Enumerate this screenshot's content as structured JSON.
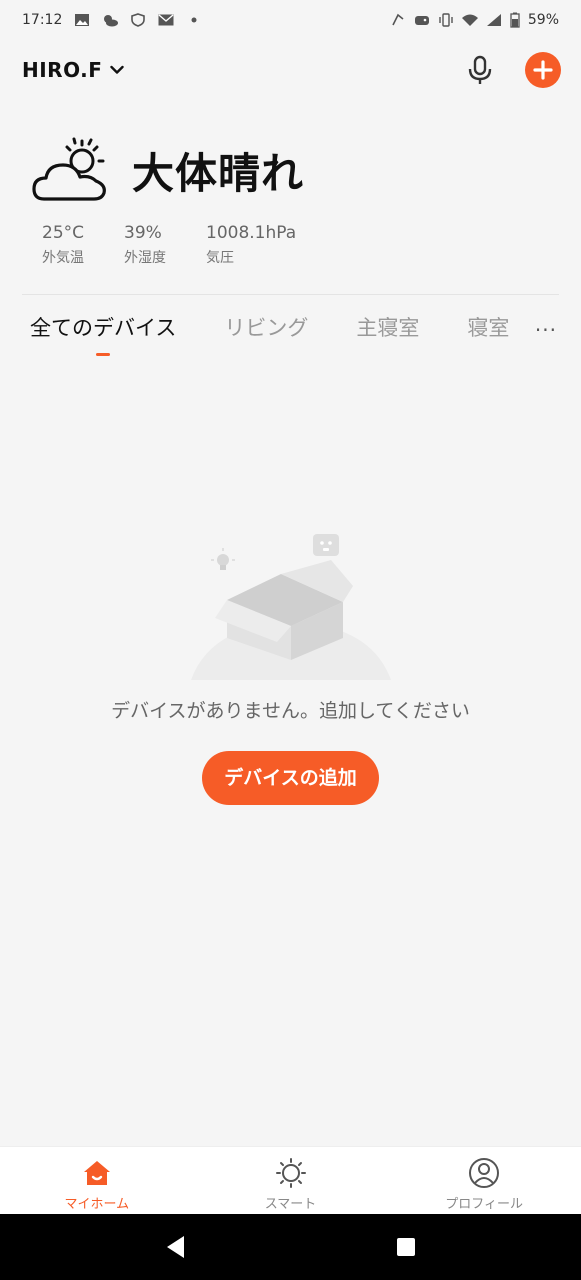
{
  "statusbar": {
    "time": "17:12",
    "left_icons": [
      "image-icon",
      "weather-icon",
      "shield-icon",
      "mail-icon",
      "dot-icon"
    ],
    "right_icons": [
      "nfc-icon",
      "gamepad-icon",
      "vibrate-icon",
      "wifi-icon",
      "signal-icon",
      "battery-icon"
    ],
    "battery": "59%"
  },
  "header": {
    "home_name": "HIRO.F"
  },
  "weather": {
    "condition": "大体晴れ",
    "stats": [
      {
        "value": "25°C",
        "label": "外気温"
      },
      {
        "value": "39%",
        "label": "外湿度"
      },
      {
        "value": "1008.1hPa",
        "label": "気圧"
      }
    ]
  },
  "tabs": {
    "items": [
      "全てのデバイス",
      "リビング",
      "主寝室",
      "寝室"
    ],
    "active_index": 0,
    "more": "···"
  },
  "empty": {
    "message": "デバイスがありません。追加してください",
    "button": "デバイスの追加"
  },
  "bottom_nav": {
    "items": [
      {
        "label": "マイホーム",
        "icon": "home-icon",
        "active": true
      },
      {
        "label": "スマート",
        "icon": "sun-icon",
        "active": false
      },
      {
        "label": "プロフィール",
        "icon": "user-icon",
        "active": false
      }
    ]
  },
  "colors": {
    "accent": "#f65c27",
    "background": "#f5f5f5"
  }
}
